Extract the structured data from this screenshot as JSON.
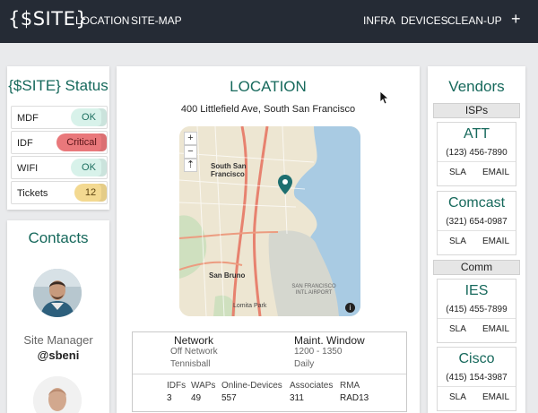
{
  "nav": {
    "brand": "{$SITE}",
    "left_links": [
      "LOCATION",
      "SITE-MAP"
    ],
    "right_links": [
      "INFRA",
      "DEVICES",
      "CLEAN-UP"
    ],
    "plus": "+"
  },
  "status": {
    "title": "{$SITE} Status",
    "rows": [
      {
        "label": "MDF",
        "value": "OK",
        "color": "#d8f2ea"
      },
      {
        "label": "IDF",
        "value": "Critical",
        "color": "#e9787b"
      },
      {
        "label": "WIFI",
        "value": "OK",
        "color": "#d8f2ea"
      },
      {
        "label": "Tickets",
        "value": "12",
        "color": "#f3d991"
      }
    ]
  },
  "contacts": {
    "title": "Contacts",
    "people": [
      {
        "role": "Site Manager",
        "handle": "@sbeni",
        "avatar": "person-avatar"
      },
      {
        "role": "",
        "handle": "",
        "avatar": "person-avatar"
      }
    ]
  },
  "location": {
    "title": "LOCATION",
    "address": "400 Littlefield Ave, South San Francisco",
    "map": {
      "zoom_in": "+",
      "zoom_out": "−",
      "compass": "⇡",
      "places": [
        "South San Francisco",
        "San Bruno",
        "SAN FRANCISCO INTL AIRPORT",
        "Lomita Park"
      ],
      "info": "i"
    },
    "network": {
      "label": "Network",
      "values": [
        "Off Network",
        "Tennisball"
      ]
    },
    "maint": {
      "label": "Maint. Window",
      "values": [
        "1200 - 1350",
        "Daily"
      ]
    },
    "stats": [
      {
        "label": "IDFs",
        "value": "3"
      },
      {
        "label": "WAPs",
        "value": "49"
      },
      {
        "label": "Online-Devices",
        "value": "557"
      },
      {
        "label": "Associates",
        "value": "311"
      },
      {
        "label": "RMA",
        "value": "RAD13"
      }
    ]
  },
  "vendors": {
    "title": "Vendors",
    "sections": [
      {
        "name": "ISPs",
        "items": [
          {
            "name": "ATT",
            "phone": "(123) 456-7890",
            "sla": "SLA",
            "email": "EMAIL"
          },
          {
            "name": "Comcast",
            "phone": "(321) 654-0987",
            "sla": "SLA",
            "email": "EMAIL"
          }
        ]
      },
      {
        "name": "Comm",
        "items": [
          {
            "name": "IES",
            "phone": "(415) 455-7899",
            "sla": "SLA",
            "email": "EMAIL"
          },
          {
            "name": "Cisco",
            "phone": "(415) 154-3987",
            "sla": "SLA",
            "email": "EMAIL"
          }
        ]
      }
    ]
  }
}
